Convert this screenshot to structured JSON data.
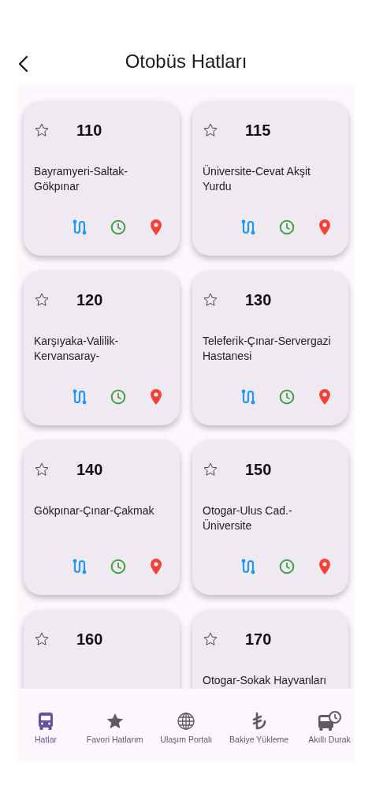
{
  "header": {
    "title": "Otobüs Hatları"
  },
  "lines": [
    {
      "number": "110",
      "route": "Bayramyeri-Saltak-Gökpınar",
      "favorite": false,
      "actions_shown": true
    },
    {
      "number": "115",
      "route": "Üniversite-Cevat Akşit Yurdu",
      "favorite": false,
      "actions_shown": true
    },
    {
      "number": "120",
      "route": "Karşıyaka-Valilik-Kervansaray-",
      "favorite": false,
      "actions_shown": true
    },
    {
      "number": "130",
      "route": "Teleferik-Çınar-Servergazi Hastanesi",
      "favorite": false,
      "actions_shown": true
    },
    {
      "number": "140",
      "route": "Gökpınar-Çınar-Çakmak",
      "favorite": false,
      "actions_shown": true
    },
    {
      "number": "150",
      "route": "Otogar-Ulus Cad.-Üniversite",
      "favorite": false,
      "actions_shown": true
    },
    {
      "number": "160",
      "favorite": false
    },
    {
      "number": "170",
      "route": "Otogar-Sokak Hayvanları",
      "favorite": false
    }
  ],
  "bottom_nav": [
    {
      "kind": "bus",
      "label": "Hatlar",
      "selected": true
    },
    {
      "kind": "star",
      "label": "Favori Hatlarım",
      "selected": false
    },
    {
      "kind": "globe",
      "label": "Ulaşım Portalı",
      "selected": false
    },
    {
      "kind": "lira",
      "label": "Bakiye Yükleme",
      "selected": false
    },
    {
      "kind": "busclock",
      "label": "Akıllı Durak",
      "selected": false
    }
  ]
}
